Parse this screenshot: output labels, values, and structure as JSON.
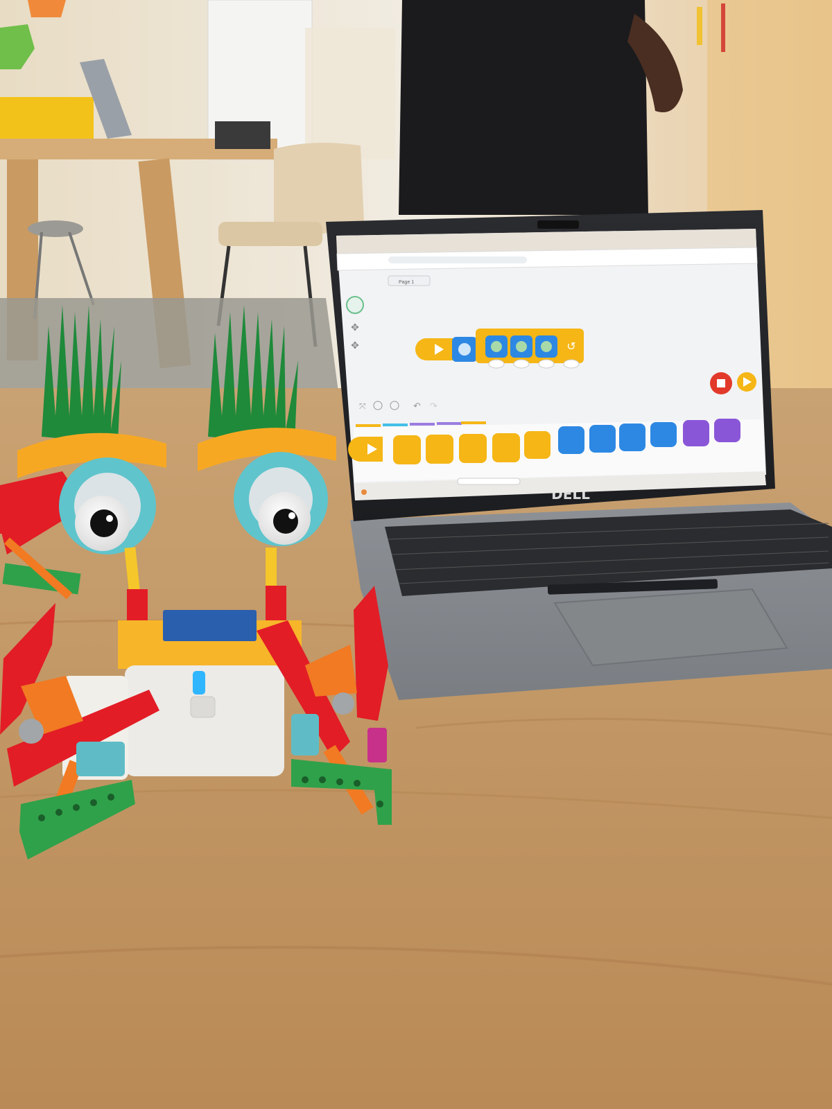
{
  "photo": {
    "subject": "LEGO robot with googly eyes in front of a laptop running a block-coding app",
    "laptop_brand": "DELL",
    "app": {
      "tab_label": "Page 1",
      "zoom_controls": [
        "zoom-in",
        "zoom-reset",
        "zoom-out"
      ],
      "palette_category_colors": [
        "#f5b616",
        "#43c0e8",
        "#9b7de0",
        "#f5b616"
      ]
    },
    "colors": {
      "table": "#c49a62",
      "laptop_body": "#8b8f93",
      "block_yellow": "#f5b616",
      "block_blue": "#2d88e3",
      "block_purple": "#8a56d8",
      "stop_red": "#e23a2a",
      "robot_red": "#e21d26",
      "robot_grass": "#1e8a3a",
      "robot_eye_ring": "#5fc4cc"
    }
  }
}
